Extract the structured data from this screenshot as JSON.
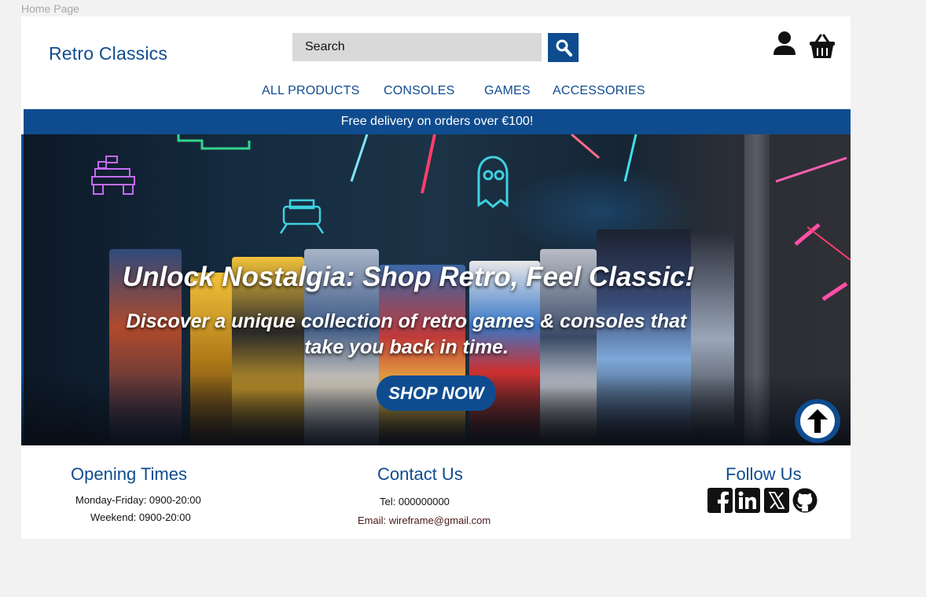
{
  "frame_label": "Home Page",
  "header": {
    "brand": "Retro Classics",
    "search_placeholder": "Search"
  },
  "nav": [
    "ALL PRODUCTS",
    "CONSOLES",
    "GAMES",
    "ACCESSORIES"
  ],
  "banner": {
    "delivery": "Free delivery on orders over €100!"
  },
  "hero": {
    "title": "Unlock Nostalgia: Shop Retro, Feel Classic!",
    "subtitle": "Discover a unique collection of retro games & consoles that take you back in time.",
    "cta": "SHOP NOW"
  },
  "footer": {
    "opening": {
      "title": "Opening Times",
      "weekday": "Monday-Friday: 0900-20:00",
      "weekend": "Weekend: 0900-20:00"
    },
    "contact": {
      "title": "Contact Us",
      "tel": "Tel: 000000000",
      "email": "Email: wireframe@gmail.com"
    },
    "follow": {
      "title": "Follow Us",
      "icons": [
        "facebook-icon",
        "linkedin-icon",
        "x-icon",
        "github-icon"
      ]
    }
  },
  "colors": {
    "brand": "#0f4c8f",
    "search_bg": "#d9d9d9",
    "canvas": "#f2f2f2"
  },
  "icons": [
    "search-icon",
    "user-icon",
    "basket-icon",
    "arrow-up-icon"
  ]
}
